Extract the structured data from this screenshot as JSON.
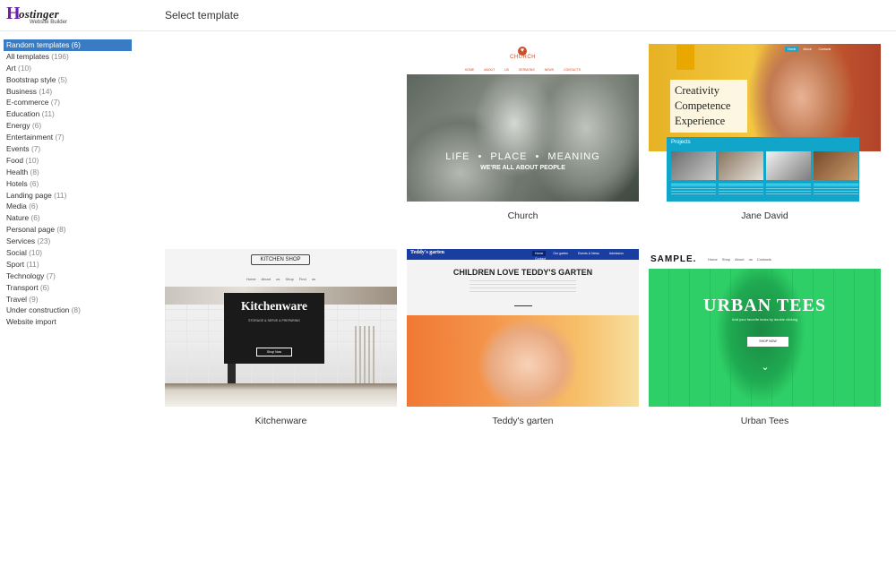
{
  "header": {
    "logo_mark": "H",
    "logo_text": "ostinger",
    "logo_sub": "Website Builder",
    "title": "Select template"
  },
  "sidebar": {
    "categories": [
      {
        "label": "Random templates",
        "count": "(6)",
        "active": true
      },
      {
        "label": "All templates",
        "count": "(196)"
      },
      {
        "label": "Art",
        "count": "(10)"
      },
      {
        "label": "Bootstrap style",
        "count": "(5)"
      },
      {
        "label": "Business",
        "count": "(14)"
      },
      {
        "label": "E-commerce",
        "count": "(7)"
      },
      {
        "label": "Education",
        "count": "(11)"
      },
      {
        "label": "Energy",
        "count": "(6)"
      },
      {
        "label": "Entertainment",
        "count": "(7)"
      },
      {
        "label": "Events",
        "count": "(7)"
      },
      {
        "label": "Food",
        "count": "(10)"
      },
      {
        "label": "Health",
        "count": "(8)"
      },
      {
        "label": "Hotels",
        "count": "(6)"
      },
      {
        "label": "Landing page",
        "count": "(11)"
      },
      {
        "label": "Media",
        "count": "(6)"
      },
      {
        "label": "Nature",
        "count": "(6)"
      },
      {
        "label": "Personal page",
        "count": "(8)"
      },
      {
        "label": "Services",
        "count": "(23)"
      },
      {
        "label": "Social",
        "count": "(10)"
      },
      {
        "label": "Sport",
        "count": "(11)"
      },
      {
        "label": "Technology",
        "count": "(7)"
      },
      {
        "label": "Transport",
        "count": "(6)"
      },
      {
        "label": "Travel",
        "count": "(9)"
      },
      {
        "label": "Under construction",
        "count": "(8)"
      },
      {
        "label": "Website import",
        "count": ""
      }
    ]
  },
  "templates": {
    "church": {
      "name": "Church",
      "logo_icon": "heart-icon",
      "site_title": "CHURCH",
      "nav": "HOME ABOUT US SERMONS NEWS CONTACTS",
      "hero_line1": "LIFE • PLACE • MEANING",
      "hero_line2": "WE'RE ALL ABOUT PEOPLE"
    },
    "jane": {
      "name": "Jane David",
      "nav": [
        "Home",
        "About",
        "Contacts"
      ],
      "hero": [
        "Creativity",
        "Competence",
        "Experience"
      ],
      "band_title": "Projects"
    },
    "kitchen": {
      "name": "Kitchenware",
      "logo": "KITCHEN SHOP",
      "nav": "Home About us Shop Find us",
      "title": "Kitchenware",
      "sub": "STORAGE & SERVE & PREPARING",
      "button": "Shop Now"
    },
    "teddy": {
      "name": "Teddy's garten",
      "logo": "Teddy's garten",
      "nav": [
        "Home",
        "Our garten",
        "Events & News",
        "Admission",
        "Contact"
      ],
      "title": "CHILDREN LOVE TEDDY'S GARTEN"
    },
    "urban": {
      "name": "Urban Tees",
      "logo": "SAMPLE.",
      "nav": "Home Shop About us Contacts",
      "title": "URBAN TEES",
      "sub": "Add your favorite looks by double clicking",
      "button": "SHOP NOW",
      "chevron": "chevron-down-icon"
    }
  },
  "colors": {
    "active_category": "#3a7cc4",
    "church_accent": "#c8502a",
    "jane_band": "#11a5c9",
    "teddy_bar": "#1a3da0",
    "urban_green": "#2ec866"
  }
}
